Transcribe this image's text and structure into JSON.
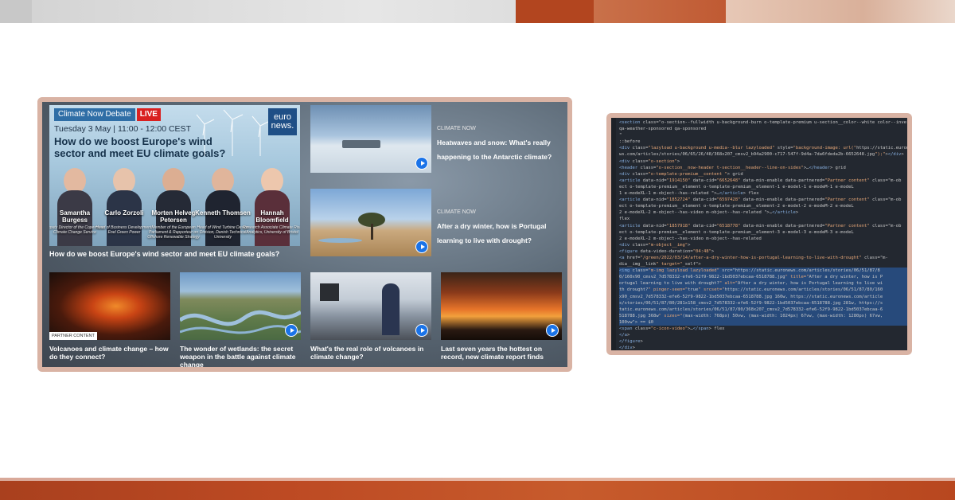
{
  "hero": {
    "tag_label": "Climate Now Debate",
    "live_label": "LIVE",
    "date_line": "Tuesday 3 May | 11:00 - 12:00 CEST",
    "headline": "How do we boost Europe's wind sector and meet EU climate goals?",
    "logo_line1": "euro",
    "logo_line2": "news.",
    "caption": "How do we boost Europe's wind sector and meet EU climate goals?",
    "panelists": [
      {
        "name": "Samantha Burgess",
        "role": "Deputy Director of the Copernicus Climate Change Service"
      },
      {
        "name": "Carlo Zorzoli",
        "role": "Head of Business Development, Enel Green Power"
      },
      {
        "name": "Morten Helveg Petersen",
        "role": "Member of the European Parliament & Rapporteur on Offshore Renewable Strategy"
      },
      {
        "name": "Kenneth Thomsen",
        "role": "Head of Wind Turbine Design Division, Danish Technical University"
      },
      {
        "name": "Hannah Bloomfield",
        "role": "Research Associate Climate Risk Analytics, University of Bristol"
      }
    ]
  },
  "right_cards": [
    {
      "kicker": "CLIMATE NOW",
      "title": "Heatwaves and snow: What's really happening to the Antarctic climate?"
    },
    {
      "kicker": "CLIMATE NOW",
      "title": "After a dry winter, how is Portugal learning to live with drought?"
    }
  ],
  "bottom_cards": [
    {
      "badge": "PARTNER CONTENT",
      "title": "Volcanoes and climate change – how do they connect?"
    },
    {
      "title": "The wonder of wetlands: the secret weapon in the battle against climate change"
    },
    {
      "title": "What's the real role of volcanoes in climate change?"
    },
    {
      "title": "Last seven years the hottest on record, new climate report finds"
    }
  ],
  "devtools_lines": [
    "<section class=\"o-section--fullwidth u-background-burn o-template-premium u-section__color--white color--invert",
    "  qa-weather-sponsored qa-sponsored",
    "  \"",
    "  ::before",
    "  <div class=\"lazyload u-background u-media--blur lazyloaded\" style=\"background-image: url(\"https://static.euronews",
    "  ws.com/articles/stories/06/65/26/48/368x207_cmsv2_b94a2900-c717-547f-9d4a-7da6fdeda2b-6652648.jpg\");\"></div>",
    "  <div class=\"o-section\">",
    "    <header class=\"o-section__now-header t-section__header--line-on-sides\">…</header> grid",
    "    <div class=\"o-template-premium__content \"> grid",
    "      <article data-nid=\"1914150\" data-cid=\"6652648\" data-min-enable data-partnered=\"Partner content\" class=\"m-ob",
    "      ect      o-template-premium__element o-template-premium__element-1       e-model-1 e-modeM-1 e-modeL",
    "      1 e-modeXL-1                     m-object--has-related          \">…</article> flex",
    "      <article data-nid=\"1852724\" data-cid=\"6597428\" data-min-enable data-partnered=\"Partner content\" class=\"m-ob",
    "      ect      o-template-premium__element o-template-premium__element-2       e-model-2 e-modeM-2 e-modeL",
    "      2 e-modeXL-2            m-object--has-video        m-object--has-related          \">…</article>",
    "      flex",
    "      <article data-nid=\"1857918\" data-cid=\"6518778\" data-min-enable data-partnered=\"Partner content\" class=\"m-ob",
    "      ect      o-template-premium__element o-template-premium__element-3       e-model-3 e-modeM-3 e-modeL",
    "      2 e-modeXL-2            m-object--has-video        m-object--has-related",
    "        <div class=\"m-object__img\">",
    "          <figure data-video-duration=\"04:48\">",
    "            <a href=\"/green/2022/03/14/after-a-dry-winter-how-is-portugal-learning-to-live-with-drought\" class=\"m-",
    "            dia__img__link\" target=\"_self\">",
    "              <img class=\"m-img lazyload lazyloaded\" src=\"https://static.euronews.com/articles/stories/06/51/87/8",
    "              0/160x90_cmsv2_7d578332-efe6-52f9-9822-1bd5037ebcaa-6518788.jpg\" title=\"After a dry winter, how is P",
    "              ortugal learning to live with drought?\" alt=\"After a dry winter, how is Portugal learning to live wi",
    "              th drought?\" pinger-seen=\"true\" srcset=\"https://static.euronews.com/articles/stories/06/51/87/80/160",
    "              x90_cmsv2_7d578332-efe6-52f9-9822-1bd5037ebcaa-6518788.jpg 160w, https://static.euronews.com/article",
    "              s/stories/06/51/87/80/281x158_cmsv2_7d578332-efe6-52f9-9822-1bd5037ebcaa-6518788.jpg 281w, https://s",
    "              tatic.euronews.com/articles/stories/06/51/87/80/368x207_cmsv2_7d578332-efe6-52f9-9822-1bd5037ebcaa-6",
    "              518788.jpg 368w\" sizes=\"(max-width: 768px) 50vw, (max-width: 1024px) 67vw, (max-width: 1280px) 67vw,",
    "              100vw\"> == $0",
    "              <span class=\"c-icon-video\">…</span> flex",
    "            </a>",
    "          </figure>",
    "        </div>",
    "        <div class=\"m-object__body\" data-partnered=\"Partner content\">…</div>"
  ],
  "colors": {
    "frame": "#d9b3a4",
    "accent_orange": "#b2451f",
    "play_blue": "#1a73e8",
    "live_red": "#d92121",
    "devtools_bg": "#232830",
    "devtools_selected": "#274a7b"
  }
}
